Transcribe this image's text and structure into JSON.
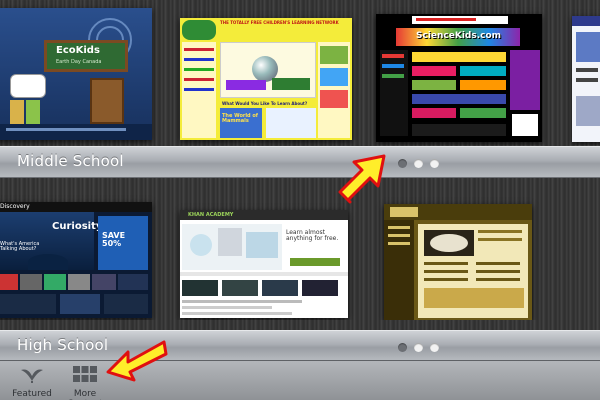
{
  "shelves": [
    {
      "title": "Middle School",
      "pages": 3,
      "active_page": 1,
      "thumbnails": [
        {
          "name": "ecokids",
          "logo": "EcoKids",
          "sub": "Earth Day Canada"
        },
        {
          "name": "childrens-learning-network",
          "headline": "THE TOTALLY FREE CHILDREN'S LEARNING NETWORK",
          "question": "What Would You Like To Learn About?",
          "banner": "The World of Mammals"
        },
        {
          "name": "science-kids",
          "logo": "ScienceKids.com"
        },
        {
          "name": "partial-site"
        }
      ]
    },
    {
      "title": "High School",
      "pages": 3,
      "active_page": 1,
      "thumbnails": [
        {
          "name": "discovery",
          "brand": "Discovery",
          "feature": "Curiosity",
          "promo": "SAVE 50%",
          "story": "What's America Talking About?"
        },
        {
          "name": "khan-academy",
          "brand": "KHAN ACADEMY",
          "tagline": "Learn almost anything for free."
        },
        {
          "name": "history-site"
        }
      ]
    }
  ],
  "tabs": [
    {
      "label": "Featured",
      "icon": "featured-icon"
    },
    {
      "label": "More Content",
      "icon": "grid-icon"
    }
  ],
  "colors": {
    "arrow_fill": "#ffee2a",
    "arrow_stroke": "#e01010",
    "bar": "#a9adb3",
    "tab_bar": "#9a9da1"
  }
}
